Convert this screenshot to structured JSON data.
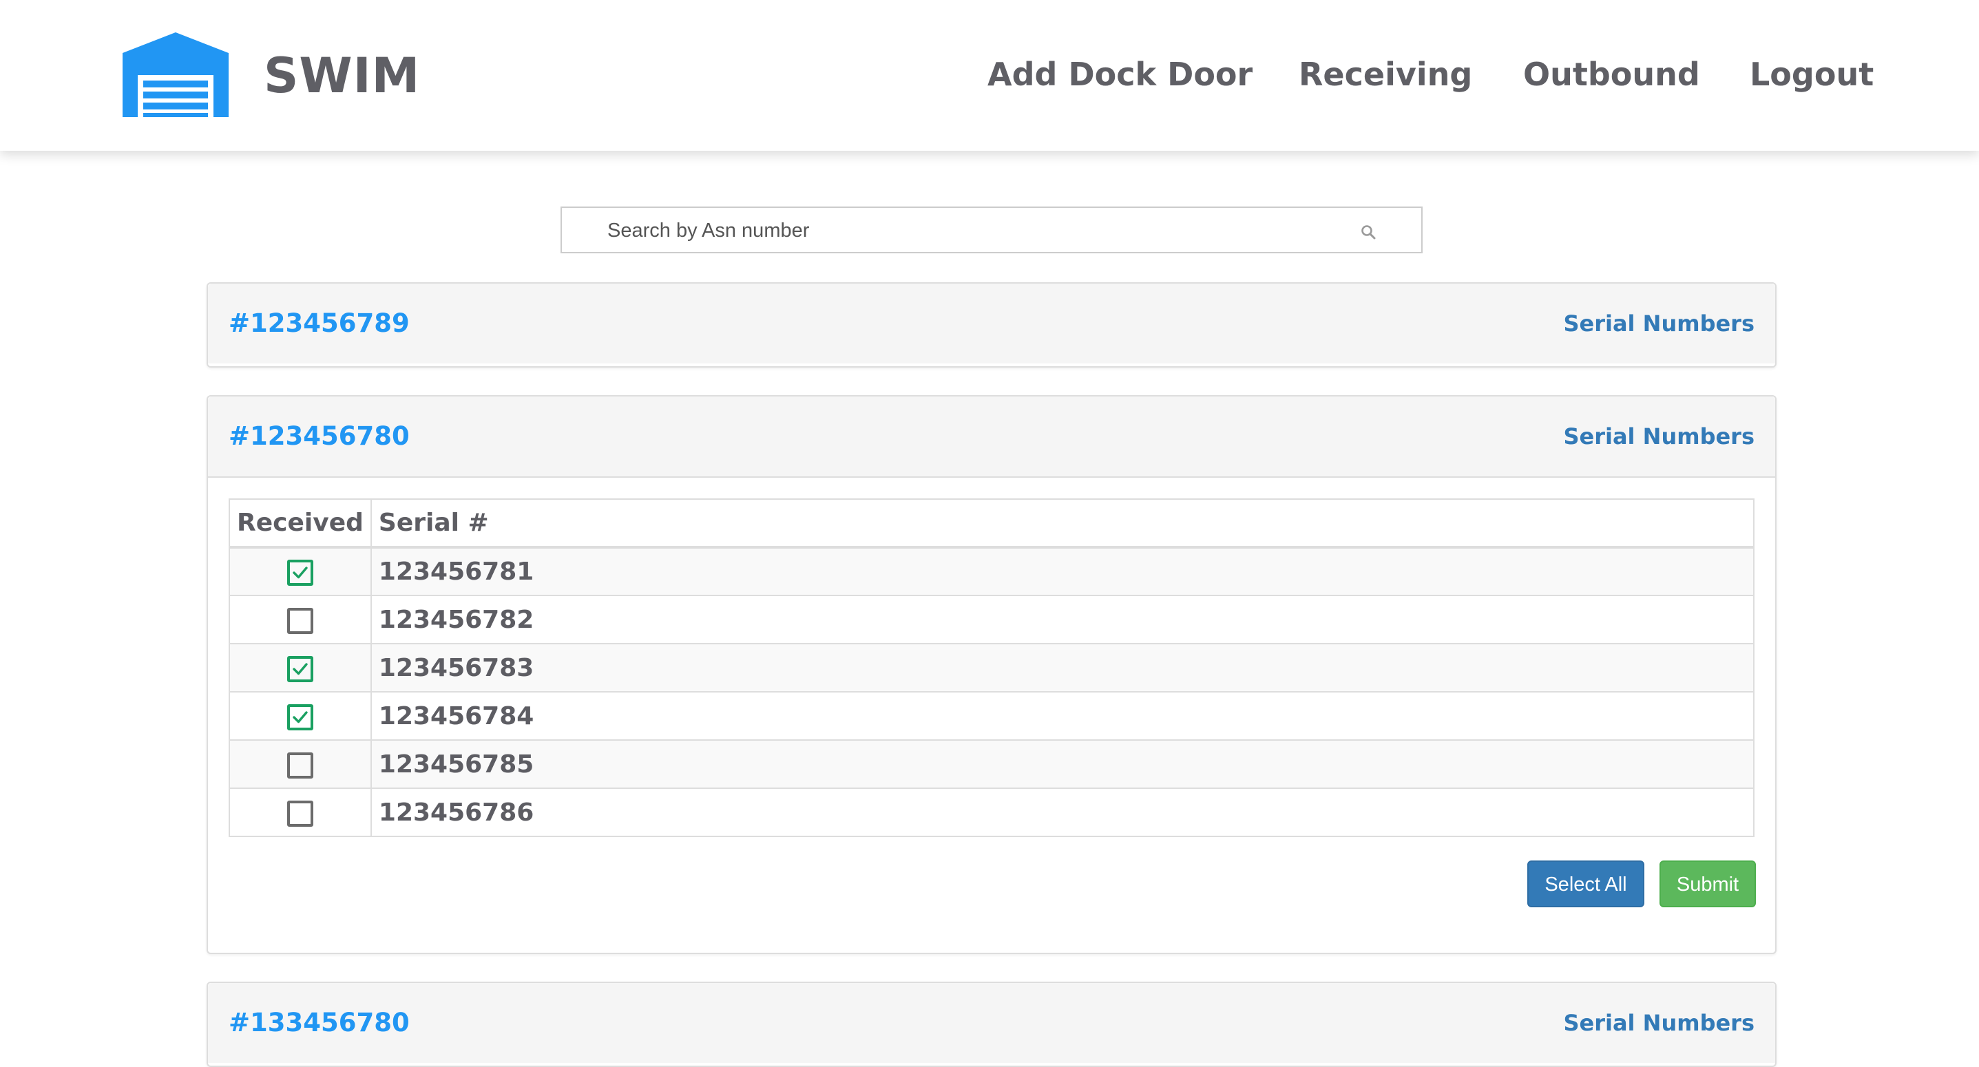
{
  "header": {
    "brand": "SWIM",
    "logo_icon": "garage-door-icon",
    "nav": [
      "Add Dock Door",
      "Receiving",
      "Outbound",
      "Logout"
    ]
  },
  "search": {
    "placeholder": "Search by Asn number",
    "value": "",
    "icon": "search-icon"
  },
  "panels": [
    {
      "asn": "#123456789",
      "serial_link": "Serial Numbers",
      "expanded": false
    },
    {
      "asn": "#123456780",
      "serial_link": "Serial Numbers",
      "expanded": true,
      "table": {
        "headers": [
          "Received",
          "Serial #"
        ],
        "rows": [
          {
            "received": true,
            "serial": "123456781"
          },
          {
            "received": false,
            "serial": "123456782"
          },
          {
            "received": true,
            "serial": "123456783"
          },
          {
            "received": true,
            "serial": "123456784"
          },
          {
            "received": false,
            "serial": "123456785"
          },
          {
            "received": false,
            "serial": "123456786"
          }
        ]
      },
      "buttons": {
        "select_all": "Select All",
        "submit": "Submit"
      }
    },
    {
      "asn": "#133456780",
      "serial_link": "Serial Numbers",
      "expanded": false
    }
  ],
  "colors": {
    "brand_blue": "#2196f3",
    "link_blue": "#337ab7",
    "check_green": "#1aa061",
    "submit_green": "#5cb85c"
  }
}
